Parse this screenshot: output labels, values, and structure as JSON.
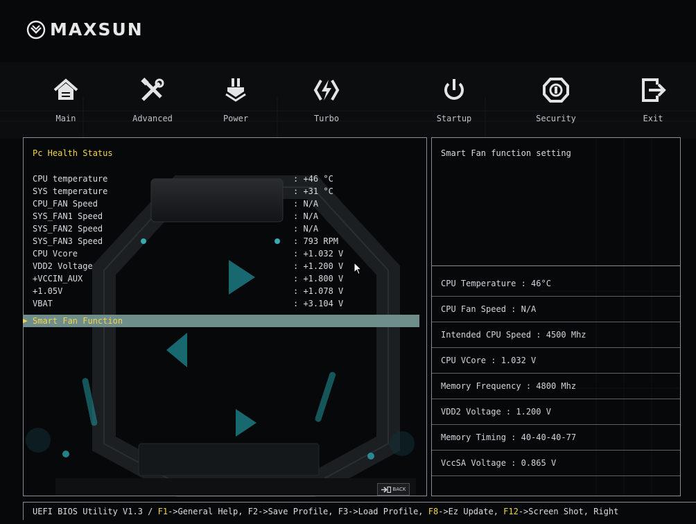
{
  "brand": {
    "name": "MAXSUN",
    "logo_icon": "maxsun-helmet-logo"
  },
  "nav": [
    {
      "label": "Main",
      "icon": "home-icon"
    },
    {
      "label": "Advanced",
      "icon": "tools-icon"
    },
    {
      "label": "Power",
      "icon": "power-plug-icon"
    },
    {
      "label": "Turbo",
      "icon": "turbo-bolt-icon"
    },
    {
      "label": "Startup",
      "icon": "startup-power-icon"
    },
    {
      "label": "Security",
      "icon": "security-shield-icon"
    },
    {
      "label": "Exit",
      "icon": "exit-icon"
    }
  ],
  "health": {
    "title": "Pc Health Status",
    "rows": [
      {
        "label": "CPU temperature",
        "value": ": +46 °C"
      },
      {
        "label": "SYS temperature",
        "value": ": +31 °C"
      },
      {
        "label": "CPU_FAN Speed",
        "value": ": N/A"
      },
      {
        "label": "SYS_FAN1 Speed",
        "value": ": N/A"
      },
      {
        "label": "SYS_FAN2 Speed",
        "value": ": N/A"
      },
      {
        "label": "SYS_FAN3 Speed",
        "value": ": 793 RPM"
      },
      {
        "label": "CPU Vcore",
        "value": ": +1.032 V"
      },
      {
        "label": "VDD2 Voltage",
        "value": ": +1.200 V"
      },
      {
        "label": "+VCCIN_AUX",
        "value": ": +1.800 V"
      },
      {
        "label": "+1.05V",
        "value": ": +1.078 V"
      },
      {
        "label": "VBAT",
        "value": ": +3.104 V"
      }
    ],
    "selected_item": "Smart Fan Function",
    "back_label": "BACK"
  },
  "help": {
    "text": "Smart Fan function setting"
  },
  "info": {
    "cpu_temperature": "CPU Temperature : 46°C",
    "cpu_fan_speed": "CPU Fan Speed : N/A",
    "intended_cpu_speed": "Intended CPU Speed : 4500 Mhz",
    "cpu_vcore": "CPU VCore : 1.032 V",
    "memory_frequency": "Memory Frequency : 4800 Mhz",
    "vdd2_voltage": "VDD2 Voltage : 1.200 V",
    "memory_timing": "Memory Timing : 40-40-40-77",
    "vccsa_voltage": "VccSA Voltage : 0.865 V"
  },
  "footer": {
    "prefix": "UEFI BIOS Utility V1.3 / ",
    "f1_key": "F1",
    "f1_text": "->General Help, F2->Save Profile, F3->Load Profile, ",
    "f8_key": "F8",
    "f8_text": "->Ez Update, ",
    "f12_key": "F12",
    "f12_text": "->Screen Shot, Right"
  },
  "colors": {
    "accent_yellow": "#f4d54a",
    "selection_bg": "#6e8d8b",
    "border": "#8a8f93",
    "background": "#070809",
    "art_cyan": "#1f8a92"
  }
}
